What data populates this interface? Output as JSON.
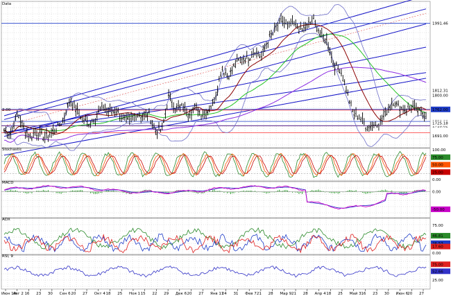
{
  "colors": {
    "background": "#ffffff",
    "grid": "#c8c8c8",
    "price": "#000000",
    "channel_blue": "#1414c8",
    "bollinger": "#6e6ec8",
    "sma_fast": "#8b0000",
    "sma_mid": "#22c322",
    "sma_slow": "#8a2be2",
    "hline_red": "#ff3030",
    "hline_blue": "#1e3cc8",
    "stoch_k": "#2a8a2a",
    "stoch_d": "#ff5500",
    "stoch_slow": "#c80000",
    "macd_line": "#c800c8",
    "macd_signal": "#3232c8",
    "macd_hist": "#1e961e",
    "adx": "#2a8a2a",
    "plus_di": "#1e3cc8",
    "minus_di": "#e02020",
    "rsi": "#3232c8"
  },
  "chart_data": [
    {
      "type": "line",
      "pane": "Data",
      "title": "Data",
      "x_tick_labels": [
        "Июн 19",
        "Авг 2",
        "16",
        "23",
        "30",
        "Сен 6",
        "20",
        "27",
        "Окт 4",
        "18",
        "25",
        "Ноя 1",
        "15",
        "22",
        "29",
        "Дек 6",
        "20",
        "27",
        "Янв 11",
        "24",
        "31",
        "Фев 7",
        "21",
        "28",
        "Мар 9",
        "21",
        "28",
        "Апр 4",
        "18",
        "25",
        "Май 3",
        "16",
        "23",
        "30",
        "Июн 6",
        "20",
        "27"
      ],
      "y_price_labels": [
        "1800.00",
        "1762.00",
        "1730.00",
        "1718.62",
        "1691.00"
      ],
      "y_tag_labels": [
        "1991.46",
        "1812.31",
        "1725.18"
      ],
      "left_label": "2.00",
      "series": [
        {
          "values": [
            1705,
            1698,
            1752,
            1712,
            1690,
            1702,
            1688,
            1695,
            1712,
            1735,
            1790,
            1760,
            1735,
            1725,
            1745,
            1770,
            1755,
            1760,
            1735,
            1730,
            1750,
            1745,
            1748,
            1705,
            1708,
            1800,
            1765,
            1770,
            1750,
            1770,
            1750,
            1760,
            1790,
            1870,
            1850,
            1880,
            1900,
            1895,
            1920,
            1900,
            1945,
            1970,
            2000,
            1985,
            1990,
            1970,
            1985,
            2000,
            1960,
            1945,
            1880,
            1870,
            1810,
            1750,
            1740,
            1715,
            1720,
            1730,
            1755,
            1785,
            1765,
            1760,
            1770,
            1755,
            1748
          ]
        }
      ],
      "hlines_red": [
        1760,
        1718,
        1700
      ],
      "hlines_blue": [
        1762,
        1730,
        1718.62
      ],
      "ylim": [
        1660,
        2050
      ]
    },
    {
      "type": "line",
      "pane": "Stochastic",
      "title": "Stochastic",
      "y_labels": [
        "100.00",
        "75.00",
        "50.00",
        "25.00",
        "0.00"
      ],
      "ylim": [
        0,
        100
      ]
    },
    {
      "type": "line",
      "pane": "MACD",
      "title": "MACD",
      "y_labels": [
        "0.00",
        "-50.00"
      ],
      "ylim": [
        -70,
        25
      ]
    },
    {
      "type": "line",
      "pane": "ADX",
      "title": "ADX",
      "y_labels": [
        "75.00",
        "46.81",
        "26.53",
        "17.60",
        "0.00"
      ],
      "ylim": [
        0,
        90
      ]
    },
    {
      "type": "line",
      "pane": "RSI",
      "title": "RSI, 9",
      "y_labels": [
        "75.00",
        "52.66",
        "25.00"
      ],
      "ylim": [
        0,
        100
      ]
    }
  ]
}
